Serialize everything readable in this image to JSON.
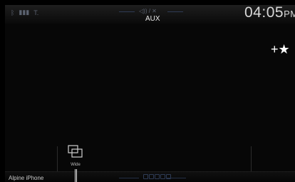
{
  "status": {
    "icons": [
      "bluetooth-icon",
      "battery-icon",
      "signal-icon"
    ],
    "mute_symbol": "◁)) / ✕"
  },
  "source": {
    "label": "AUX"
  },
  "clock": {
    "time": "04:05",
    "ampm": "PM"
  },
  "side": {
    "favorite_symbol": "+★",
    "chevron": "〈"
  },
  "display_button": {
    "label": "Wide"
  },
  "bottom_bar": {
    "device_name": "Alpine iPhone",
    "page_count": 5
  }
}
